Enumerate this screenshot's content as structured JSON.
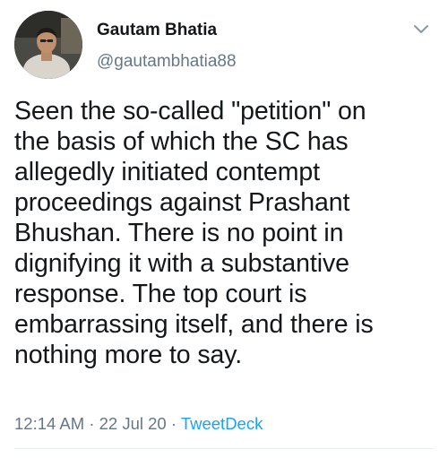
{
  "tweet": {
    "author": {
      "display_name": "Gautam Bhatia",
      "handle": "@gautambhatia88"
    },
    "text_lines": [
      "Seen the so-called \"petition\" on",
      "the basis of which the SC has",
      "allegedly initiated contempt",
      "proceedings against Prashant",
      "Bhushan. There is no point in",
      "dignifying it with a substantive",
      "response. The top court is",
      "embarrassing itself, and there is",
      "nothing more to say."
    ],
    "time": "12:14 AM",
    "separator": "·",
    "date": "22 Jul 20",
    "source": "TweetDeck"
  },
  "icons": {
    "menu": "chevron-down-icon",
    "avatar": "avatar"
  },
  "colors": {
    "text": "#14171a",
    "secondary": "#657786",
    "link": "#1da1f2",
    "divider": "#e6ecf0"
  }
}
